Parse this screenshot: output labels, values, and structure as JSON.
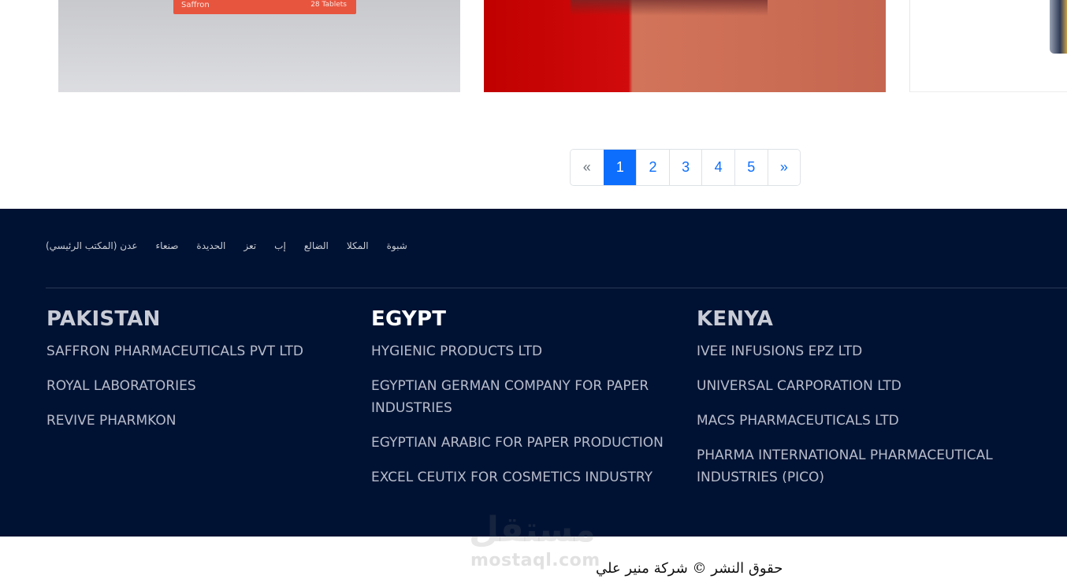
{
  "products": {
    "card1": {
      "brand": "Saffron",
      "count": "28 Tablets"
    }
  },
  "pagination": {
    "prev": "«",
    "pages": [
      "1",
      "2",
      "3",
      "4",
      "5"
    ],
    "next": "»",
    "active": "1"
  },
  "footer": {
    "branches": [
      "عدن (المكتب الرئيسي)",
      "صنعاء",
      "الحديدة",
      "تعز",
      "إب",
      "الضالع",
      "المكلا",
      "شبوة"
    ],
    "columns": [
      {
        "title": "PAKISTAN",
        "companies": [
          "SAFFRON PHARMACEUTICALS PVT LTD",
          "ROYAL LABORATORIES",
          "REVIVE PHARMKON"
        ]
      },
      {
        "title": "EGYPT",
        "companies": [
          "HYGIENIC PRODUCTS LTD",
          "EGYPTIAN GERMAN COMPANY FOR PAPER INDUSTRIES",
          "EGYPTIAN ARABIC FOR PAPER PRODUCTION",
          "EXCEL CEUTIX FOR COSMETICS INDUSTRY"
        ]
      },
      {
        "title": "KENYA",
        "companies": [
          "IVEE INFUSIONS EPZ LTD",
          "UNIVERSAL CARPORATION LTD",
          "MACS PHARMACEUTICALS LTD",
          "PHARMA INTERNATIONAL PHARMACEUTICAL INDUSTRIES (PICO)"
        ]
      }
    ]
  },
  "copyright": {
    "text": "حقوق النشر © شركة منير علي"
  },
  "watermark": {
    "arabic": "مستقل",
    "latin": "mostaql.com"
  },
  "colors": {
    "footer_bg": "#001233",
    "accent": "#0d6efd"
  }
}
